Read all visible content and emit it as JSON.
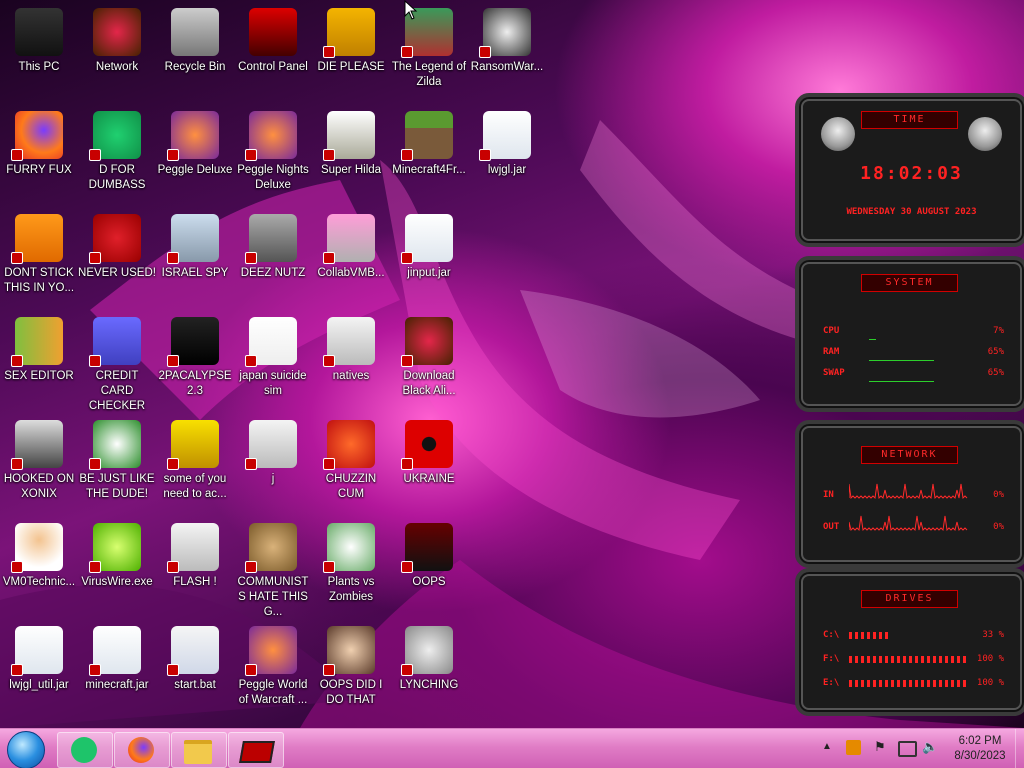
{
  "desktop": {
    "icons": [
      {
        "label": "This PC",
        "icon": "computer-icon"
      },
      {
        "label": "FURRY FUX",
        "icon": "firefox-icon"
      },
      {
        "label": "DONT STICK THIS IN YO...",
        "icon": "vlc-icon"
      },
      {
        "label": "SEX EDITOR",
        "icon": "hex-editor-icon"
      },
      {
        "label": "HOOKED ON XONIX",
        "icon": "xonix-icon"
      },
      {
        "label": "VM0Technic...",
        "icon": "doctor-icon"
      },
      {
        "label": "lwjgl_util.jar",
        "icon": "java-icon"
      },
      {
        "label": "Network",
        "icon": "alien-icon"
      },
      {
        "label": "D FOR DUMBASS",
        "icon": "green-app-icon"
      },
      {
        "label": "NEVER USED!",
        "icon": "devcpp-icon"
      },
      {
        "label": "CREDIT CARD CHECKER",
        "icon": "credit-card-icon"
      },
      {
        "label": "BE JUST LIKE THE DUDE!",
        "icon": "gnome-icon"
      },
      {
        "label": "VirusWire.exe",
        "icon": "lime-icon"
      },
      {
        "label": "minecraft.jar",
        "icon": "java-icon"
      },
      {
        "label": "Recycle Bin",
        "icon": "recycle-bin-icon"
      },
      {
        "label": "Peggle Deluxe",
        "icon": "peggle-icon"
      },
      {
        "label": "ISRAEL SPY",
        "icon": "network-spy-icon"
      },
      {
        "label": "2PACALYPSE 2.3",
        "icon": "terminal-icon"
      },
      {
        "label": "some of you need to ac...",
        "icon": "beaver-icon"
      },
      {
        "label": "FLASH !",
        "icon": "document-icon"
      },
      {
        "label": "start.bat",
        "icon": "batch-gear-icon"
      },
      {
        "label": "Control Panel",
        "icon": "control-panel-icon"
      },
      {
        "label": "Peggle Nights Deluxe",
        "icon": "peggle-icon"
      },
      {
        "label": "DEEZ NUTZ",
        "icon": "windows-stack-icon"
      },
      {
        "label": "japan suicide sim",
        "icon": "japan-sim-icon"
      },
      {
        "label": "j",
        "icon": "document-icon"
      },
      {
        "label": "COMMUNISTS HATE THIS G...",
        "icon": "money-bag-icon"
      },
      {
        "label": "Peggle World of Warcraft ...",
        "icon": "peggle-icon"
      },
      {
        "label": "DIE PLEASE",
        "icon": "de-icon"
      },
      {
        "label": "Super Hilda",
        "icon": "pixel-game-icon"
      },
      {
        "label": "CollabVMB...",
        "icon": "monitor-icon"
      },
      {
        "label": "natives",
        "icon": "document-icon"
      },
      {
        "label": "CHUZZIN CUM",
        "icon": "chuzzle-icon"
      },
      {
        "label": "Plants vs Zombies",
        "icon": "flower-icon"
      },
      {
        "label": "OOPS DID I DO THAT",
        "icon": "portrait-icon"
      },
      {
        "label": "The Legend of Zilda",
        "icon": "zelda-icon"
      },
      {
        "label": "Minecraft4Fr...",
        "icon": "grass-block-icon"
      },
      {
        "label": "jinput.jar",
        "icon": "java-icon"
      },
      {
        "label": "Download Black Ali...",
        "icon": "alien-icon"
      },
      {
        "label": "UKRAINE",
        "icon": "radiation-icon"
      },
      {
        "label": "OOPS",
        "icon": "red-monitor-icon"
      },
      {
        "label": "LYNCHING",
        "icon": "knot-icon"
      },
      {
        "label": "RansomWar...",
        "icon": "skull-icon"
      },
      {
        "label": "lwjgl.jar",
        "icon": "java-icon"
      }
    ]
  },
  "widgets": {
    "time": {
      "title": "TIME",
      "clock": "18:02:03",
      "date": "WEDNESDAY 30 AUGUST 2023"
    },
    "system": {
      "title": "SYSTEM",
      "rows": [
        {
          "label": "CPU",
          "value": "7%",
          "fill": 0.07
        },
        {
          "label": "RAM",
          "value": "65%",
          "fill": 0.65
        },
        {
          "label": "SWAP",
          "value": "65%",
          "fill": 0.65
        }
      ]
    },
    "network": {
      "title": "NETWORK",
      "rows": [
        {
          "label": "IN",
          "value": "0%"
        },
        {
          "label": "OUT",
          "value": "0%"
        }
      ]
    },
    "drives": {
      "title": "DRIVES",
      "rows": [
        {
          "label": "C:\\",
          "value": "33 %",
          "fill": 0.33
        },
        {
          "label": "F:\\",
          "value": "100 %",
          "fill": 1.0
        },
        {
          "label": "E:\\",
          "value": "100 %",
          "fill": 1.0
        }
      ]
    }
  },
  "taskbar": {
    "pinned": [
      {
        "name": "green-app",
        "icon": "green-app-icon"
      },
      {
        "name": "firefox",
        "icon": "firefox-icon"
      },
      {
        "name": "file-explorer",
        "icon": "folder-icon"
      },
      {
        "name": "control-panel",
        "icon": "control-panel-icon"
      }
    ],
    "clock_time": "6:02 PM",
    "clock_date": "8/30/2023"
  },
  "colors": {
    "accent_red": "#ff2222",
    "taskbar_pink": "#e07cc5"
  }
}
